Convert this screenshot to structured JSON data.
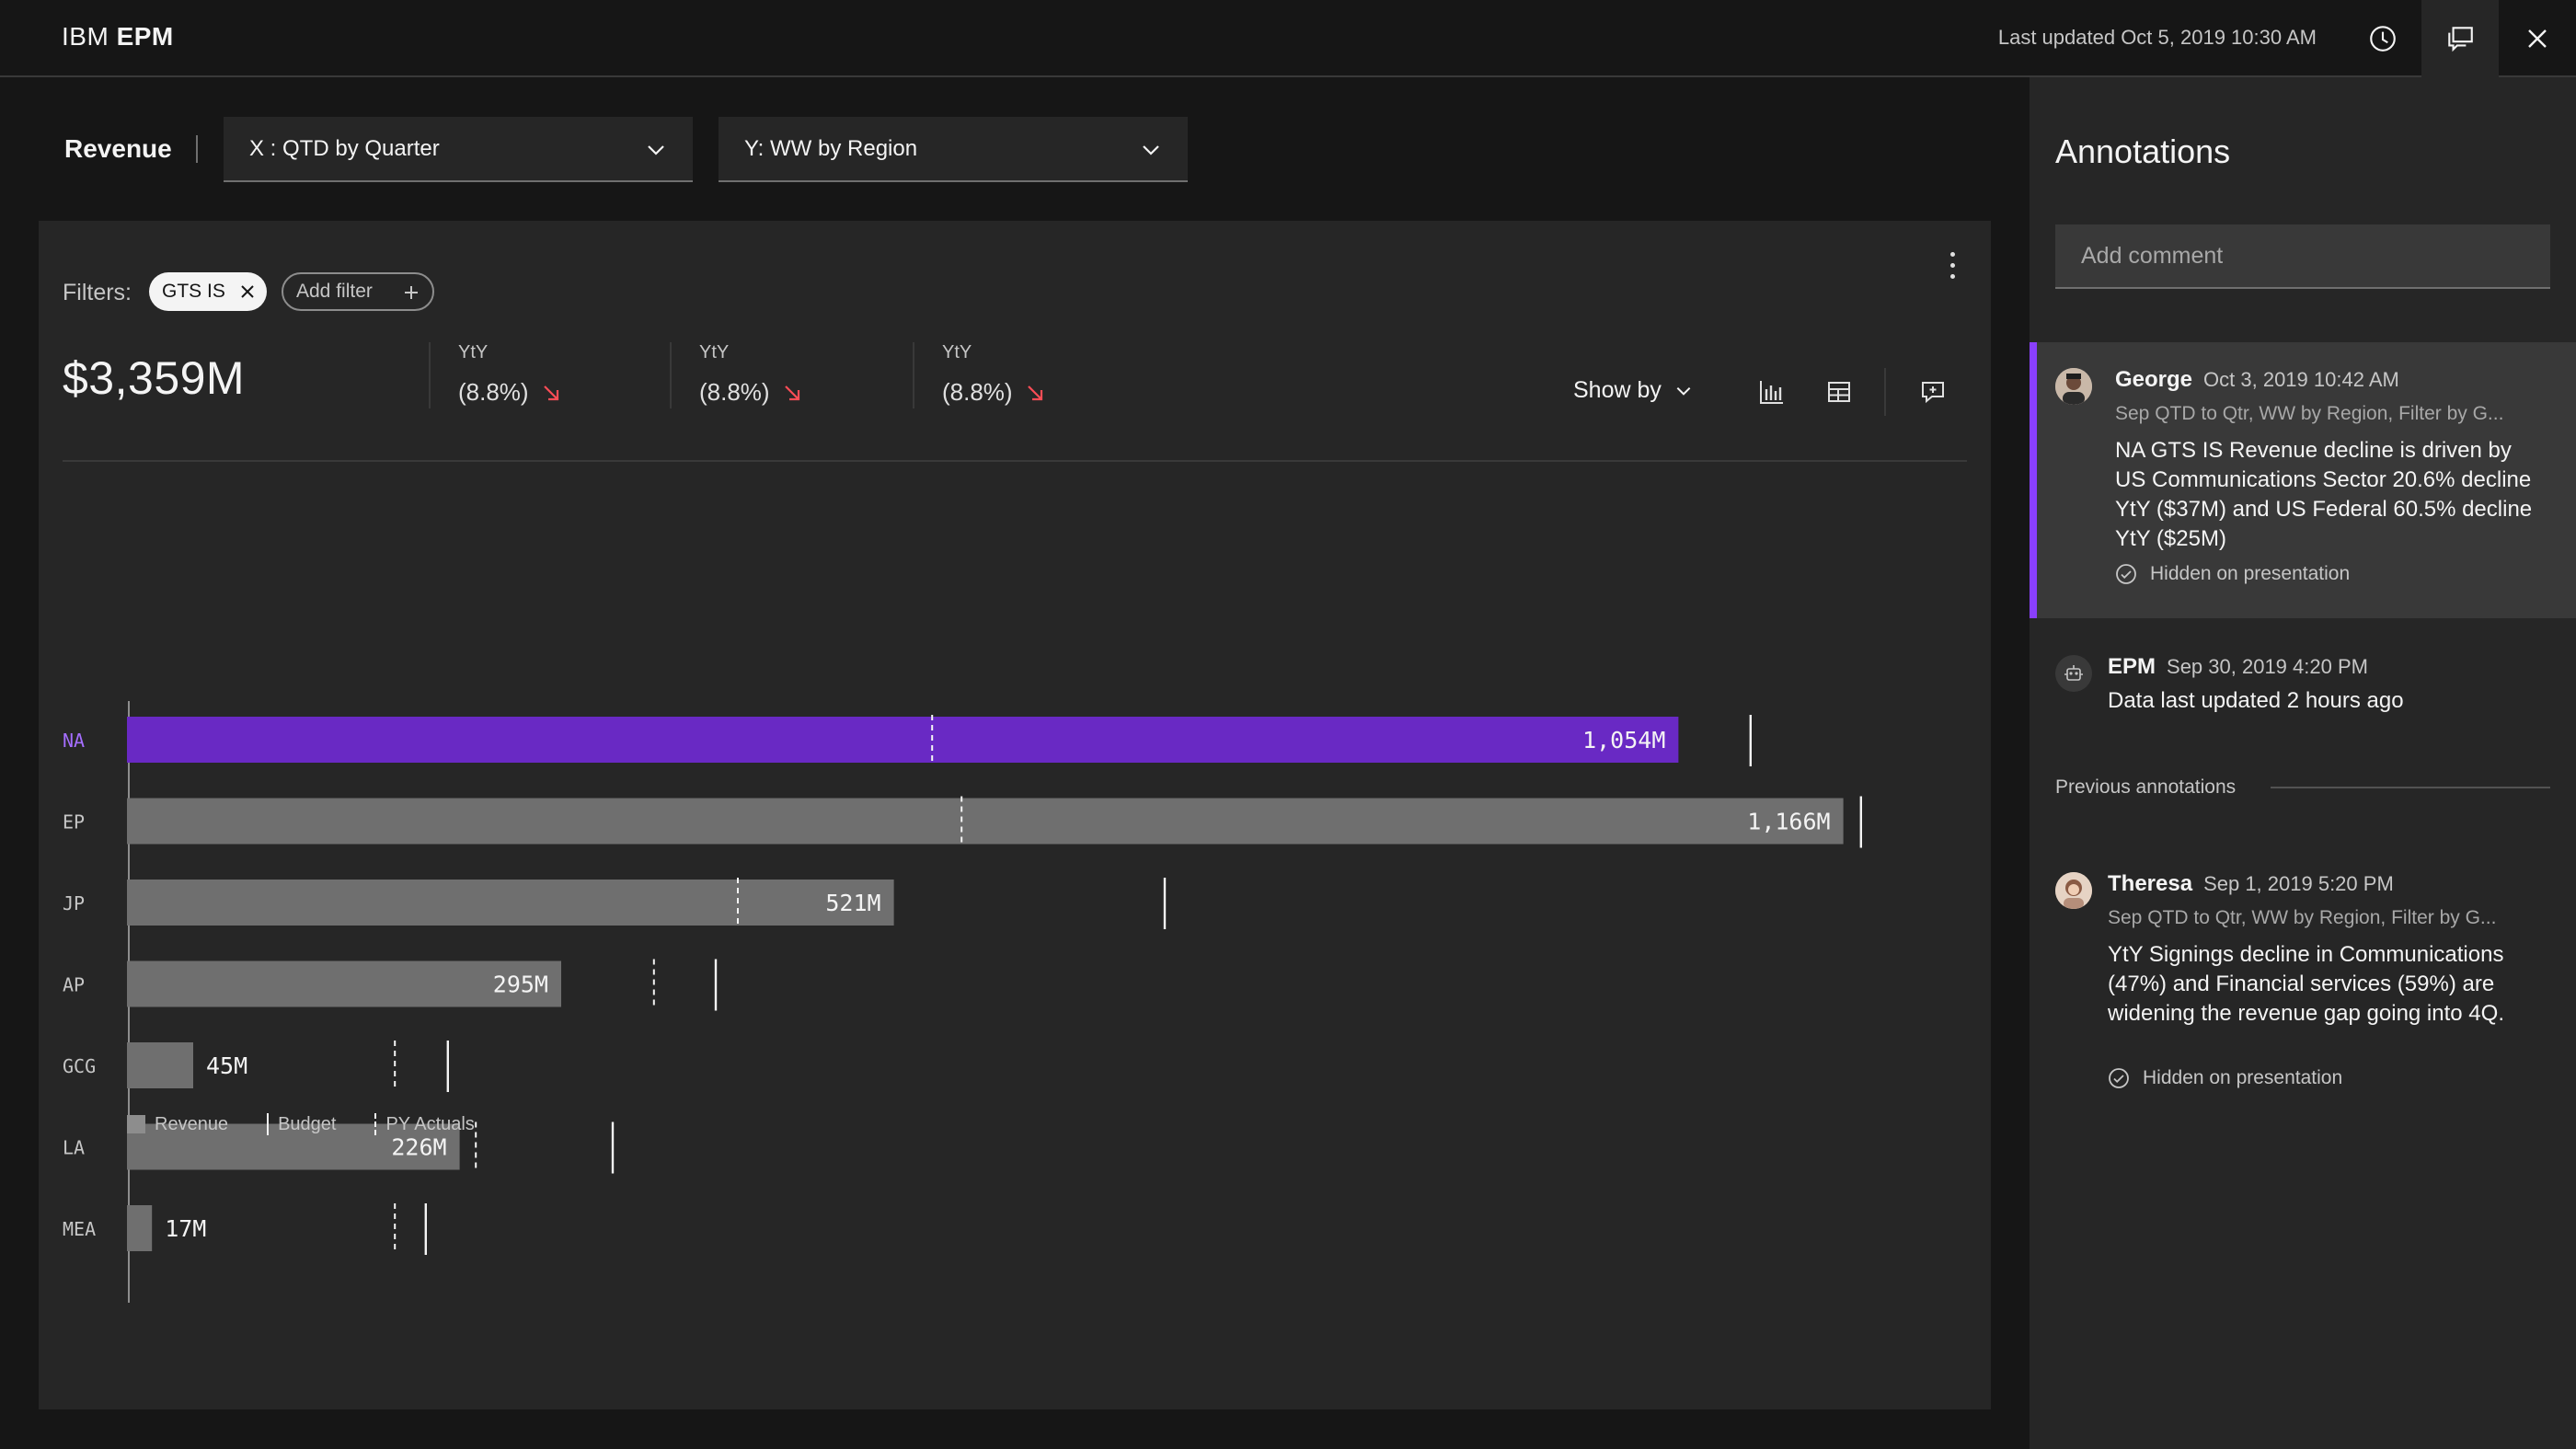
{
  "header": {
    "brand_prefix": "IBM",
    "brand_name": "EPM",
    "last_updated": "Last updated Oct 5, 2019 10:30 AM"
  },
  "toolbar": {
    "title": "Revenue",
    "x_dropdown": "X : QTD by Quarter",
    "y_dropdown": "Y: WW by Region"
  },
  "filters": {
    "label": "Filters:",
    "active": "GTS IS",
    "add_label": "Add filter"
  },
  "kpis": {
    "total": "$3,359M",
    "items": [
      {
        "label": "YtY",
        "value": "(8.8%)"
      },
      {
        "label": "YtY",
        "value": "(8.8%)"
      },
      {
        "label": "YtY",
        "value": "(8.8%)"
      }
    ],
    "show_by": "Show by"
  },
  "colors": {
    "highlight": "#6929c4",
    "bar": "#6f6f6f",
    "decline": "#fa4d56",
    "accent_border": "#8a3ffc"
  },
  "chart_data": {
    "type": "bar",
    "orientation": "horizontal",
    "categories": [
      "NA",
      "EP",
      "JP",
      "AP",
      "GCG",
      "LA",
      "MEA"
    ],
    "series": [
      {
        "name": "Revenue",
        "values": [
          1054,
          1166,
          521,
          295,
          45,
          226,
          17
        ],
        "labels": [
          "1,054M",
          "1,166M",
          "521M",
          "295M",
          "45M",
          "226M",
          "17M"
        ]
      },
      {
        "name": "Budget",
        "values": [
          1103,
          1178,
          705,
          400,
          218,
          330,
          203
        ]
      },
      {
        "name": "PY Actuals",
        "values": [
          547,
          567,
          415,
          358,
          182,
          237,
          182
        ]
      }
    ],
    "highlighted_category": "NA",
    "xlim": [
      0,
      1160
    ],
    "grid": false,
    "legend": "bottom-left"
  },
  "annotations": {
    "title": "Annotations",
    "add_placeholder": "Add comment",
    "previous_label": "Previous annotations",
    "items": [
      {
        "author": "George",
        "date": "Oct 3, 2019 10:42 AM",
        "meta": "Sep QTD to Qtr, WW by Region, Filter by G...",
        "body": "NA GTS IS Revenue decline is driven by US Communications Sector 20.6% decline YtY ($37M) and US Federal 60.5% decline YtY ($25M)",
        "status": "Hidden on presentation"
      },
      {
        "author": "EPM",
        "date": "Sep 30, 2019 4:20 PM",
        "body": "Data last updated 2 hours ago"
      },
      {
        "author": "Theresa",
        "date": "Sep 1, 2019 5:20 PM",
        "meta": "Sep QTD to Qtr, WW by Region, Filter by G...",
        "body": "YtY Signings decline in Communications (47%) and Financial services (59%) are widening the revenue gap going into 4Q.",
        "status": "Hidden on presentation"
      }
    ]
  },
  "icons": [
    "history-icon",
    "annotations-toggle-icon",
    "close-icon",
    "chevron-down-icon",
    "close-tag-icon",
    "add-icon",
    "overflow-menu-icon",
    "arrow-down-right-icon",
    "bar-chart-icon",
    "table-icon",
    "add-comment-icon",
    "checkmark-outline-icon",
    "bot-icon"
  ]
}
